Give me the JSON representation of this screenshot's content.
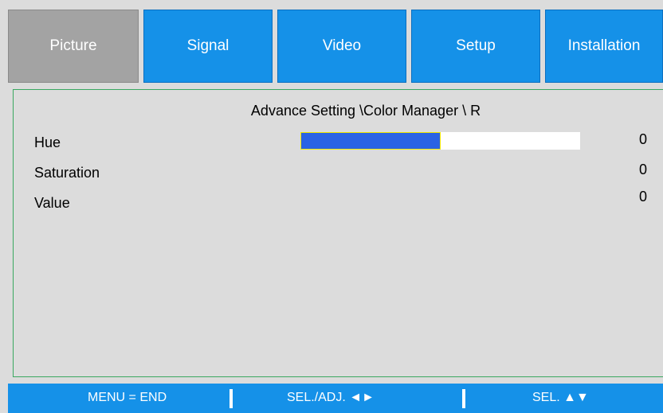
{
  "tabs": [
    {
      "label": "Picture",
      "active": true
    },
    {
      "label": "Signal",
      "active": false
    },
    {
      "label": "Video",
      "active": false
    },
    {
      "label": "Setup",
      "active": false
    },
    {
      "label": "Installation",
      "active": false
    }
  ],
  "breadcrumb": "Advance Setting \\Color Manager \\ R",
  "settings": [
    {
      "label": "Hue",
      "value": "0",
      "slider_level": 0.5
    },
    {
      "label": "Saturation",
      "value": "0"
    },
    {
      "label": "Value",
      "value": "0"
    }
  ],
  "footer": {
    "menu_hint": "MENU = END",
    "adjust_hint": "SEL./ADJ. ◄►",
    "select_hint": "SEL. ▲▼"
  },
  "colors": {
    "tab_active": "#a3a3a3",
    "tab": "#1591e8",
    "panel_bg": "#dcdcdc",
    "slider_fill": "#2a63e4",
    "slider_focus_border": "#f2e800",
    "panel_border": "#3aa860"
  }
}
